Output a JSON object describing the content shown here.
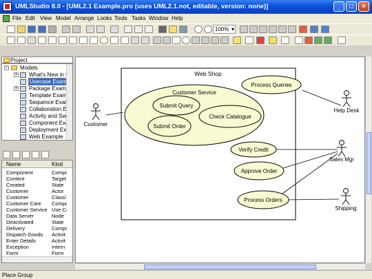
{
  "window": {
    "title": "UMLStudio 8.0 - [UML2.1 Example.pro (uses UML2.1.not, editable, version: none)]",
    "minimize_label": "_",
    "maximize_label": "□",
    "close_label": "×"
  },
  "menu": {
    "items": [
      "File",
      "Edit",
      "View",
      "Model",
      "Arrange",
      "Looks",
      "Tools",
      "Tasks",
      "Window",
      "Help"
    ]
  },
  "toolbar": {
    "zoom_value": "100%"
  },
  "project_tree": {
    "header": "Project",
    "root": "Models",
    "items": [
      "What's New in UML",
      "Usecase Example",
      "Package Example",
      "Template Example",
      "Sequence Example",
      "Collaboration Exa",
      "Activity and Swim",
      "Component Exam",
      "Deployment Exam",
      "Web Example"
    ],
    "selected_index": 1
  },
  "properties": {
    "columns": [
      "Name",
      "Kind"
    ],
    "rows": [
      [
        "Component",
        "Compo"
      ],
      [
        "Content",
        "Target"
      ],
      [
        "Created",
        "State"
      ],
      [
        "Customer",
        "Actor"
      ],
      [
        "Customer",
        "Class/"
      ],
      [
        "Customer Care",
        "Compo"
      ],
      [
        "Customer Service",
        "Use Ca"
      ],
      [
        "Data Server",
        "Node"
      ],
      [
        "Deactivated",
        "State"
      ],
      [
        "Delivery",
        "Compo"
      ],
      [
        "Dispatch Goods",
        "Activit"
      ],
      [
        "Enter Details",
        "Activit"
      ],
      [
        "Exception",
        "Intern"
      ],
      [
        "Form",
        "Form"
      ]
    ]
  },
  "diagram": {
    "system_name": "Web Shop",
    "composite_usecase": "Customer Service",
    "inner_usecases": [
      "Submit Query",
      "Submit Order",
      "Check Catalogue"
    ],
    "usecases": [
      "Process Queries",
      "Verify Credit",
      "Approve Order",
      "Process Orders"
    ],
    "actors": [
      "Customer",
      "Help Desk",
      "Sales Mgr",
      "Shipping"
    ]
  },
  "status": {
    "text": "Place Group"
  },
  "colors": {
    "title_bar": "#0a4fd8",
    "usecase_fill": "#fafad2",
    "selection": "#316ac5"
  }
}
